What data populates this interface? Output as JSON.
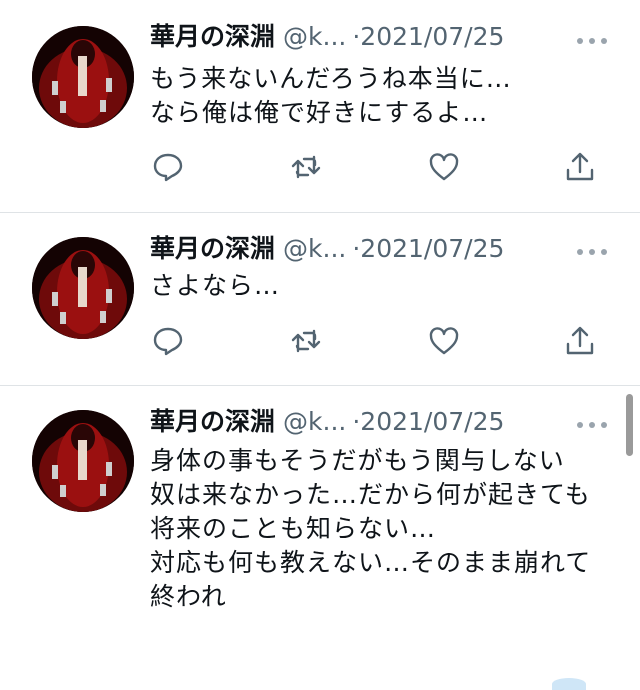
{
  "tweets": [
    {
      "name": "華月の深淵",
      "handle": "@k...",
      "sep": "·",
      "date": "2021/07/25",
      "text": "もう来ないんだろうね本当に…\nなら俺は俺で好きにするよ…"
    },
    {
      "name": "華月の深淵",
      "handle": "@k...",
      "sep": "·",
      "date": "2021/07/25",
      "text": "さよなら…"
    },
    {
      "name": "華月の深淵",
      "handle": "@k...",
      "sep": "·",
      "date": "2021/07/25",
      "text": "身体の事もそうだがもう関与しない\n奴は来なかった…だから何が起きても将来のことも知らない…\n対応も何も教えない…そのまま崩れて終われ"
    }
  ],
  "icons": {
    "reply": "reply-icon",
    "retweet": "retweet-icon",
    "like": "like-icon",
    "share": "share-icon",
    "more": "more-icon"
  },
  "colors": {
    "text": "#0f1419",
    "muted": "#536471",
    "divider": "#dfe3e6"
  }
}
